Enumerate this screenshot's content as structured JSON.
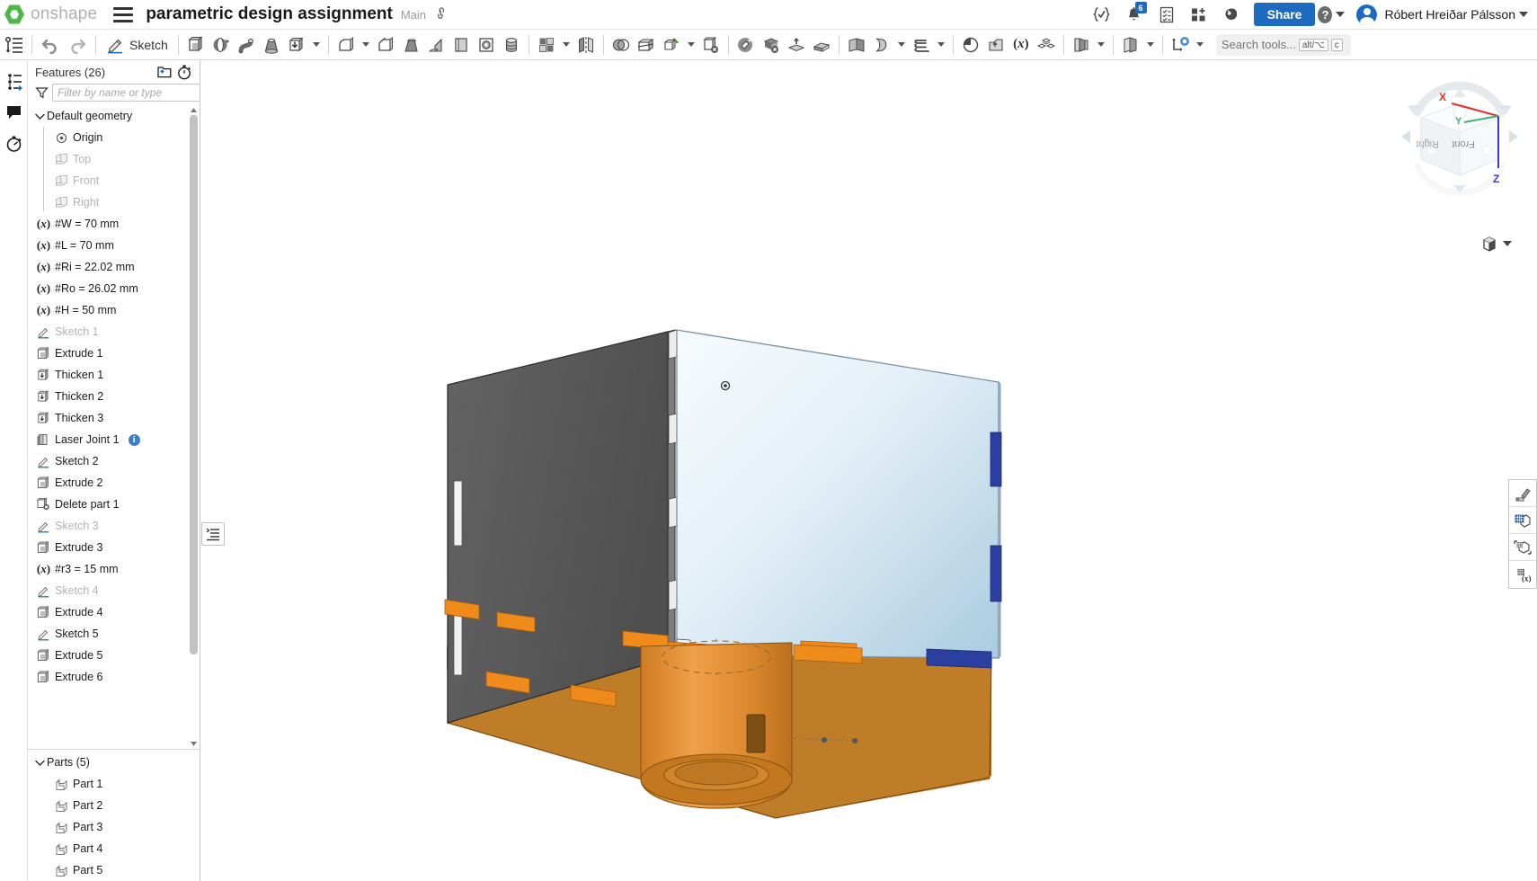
{
  "header": {
    "brand": "onshape",
    "menu_icon": "hamburger-icon",
    "doc_title": "parametric design assignment",
    "branch": "Main",
    "link_icon": "link-icon",
    "icons": [
      {
        "name": "feature-script-icon",
        "glyph": "{✓}"
      },
      {
        "name": "notifications-icon",
        "glyph": "bell",
        "badge": "6"
      },
      {
        "name": "tasks-icon",
        "glyph": "checklist"
      },
      {
        "name": "apps-icon",
        "glyph": "grid-plus"
      },
      {
        "name": "learning-icon",
        "glyph": "brain"
      }
    ],
    "share_label": "Share",
    "help_icon": "question-mark-icon",
    "user_name": "Róbert Hreiðar Pálsson"
  },
  "toolbar": {
    "feature_list_icon": "feature-list-icon",
    "undo_icon": "undo-arrow-icon",
    "redo_icon": "redo-arrow-icon",
    "sketch_label": "Sketch",
    "sketch_icon": "pencil-icon",
    "tools": [
      {
        "name": "extrude-tool",
        "icon": "extrude-icon"
      },
      {
        "name": "revolve-tool",
        "icon": "revolve-icon"
      },
      {
        "name": "sweep-tool",
        "icon": "sweep-icon"
      },
      {
        "name": "loft-tool",
        "icon": "loft-icon"
      },
      {
        "name": "thicken-tool",
        "icon": "thicken-icon",
        "caret": true
      },
      {
        "name": "fillet-tool",
        "icon": "fillet-icon",
        "caret": true
      },
      {
        "name": "chamfer-tool",
        "icon": "chamfer-icon"
      },
      {
        "name": "draft-tool",
        "icon": "draft-icon"
      },
      {
        "name": "rib-tool",
        "icon": "rib-icon"
      },
      {
        "name": "shell-tool",
        "icon": "shell-icon"
      },
      {
        "name": "hole-tool",
        "icon": "hole-icon"
      },
      {
        "name": "thread-tool",
        "icon": "thread-icon"
      }
    ],
    "pattern_icon": "pattern-icon",
    "mirror_icon": "mirror-icon",
    "boolean_icon": "boolean-icon",
    "split_icon": "split-icon",
    "transform_icon": "transform-icon",
    "delete_face_icon": "delete-face-icon",
    "move_face_icon": "move-face-icon",
    "replace_face_icon": "replace-face-icon",
    "offset_surface_icon": "offset-surface-icon",
    "delete_part_icon": "delete-part-icon",
    "enclose_icon": "enclose-icon",
    "surface_icon": "surface-icon",
    "curve_icon": "curve-icon",
    "derived_icon": "derived-icon",
    "import_icon": "import-icon",
    "variable_icon": "variable-icon",
    "assembly_icon": "assembly-icon",
    "sheet_metal_icon": "sheet-metal-icon",
    "config_icon": "config-icon",
    "custom_feature_icon": "custom-feature-icon",
    "search_placeholder": "Search tools...",
    "search_key_alt": "alt/⌥",
    "search_key_c": "c"
  },
  "left_rail": [
    {
      "name": "rail-insert-icon",
      "label": "insert"
    },
    {
      "name": "rail-comments-icon",
      "label": "comments"
    },
    {
      "name": "rail-history-icon",
      "label": "history"
    }
  ],
  "tree": {
    "title": "Features (26)",
    "new_folder_icon": "new-folder-icon",
    "rollback_icon": "rollback-timer-icon",
    "filter_icon": "filter-funnel-icon",
    "filter_placeholder": "Filter by name or type",
    "groups": [
      {
        "name": "Default geometry",
        "expanded": true,
        "children": [
          {
            "label": "Origin",
            "icon": "origin-icon",
            "dim": false
          },
          {
            "label": "Top",
            "icon": "plane-icon",
            "dim": true
          },
          {
            "label": "Front",
            "icon": "plane-icon",
            "dim": true
          },
          {
            "label": "Right",
            "icon": "plane-icon",
            "dim": true
          }
        ]
      }
    ],
    "features": [
      {
        "label": "#W = 70 mm",
        "icon": "variable-icon",
        "dim": false
      },
      {
        "label": "#L = 70 mm",
        "icon": "variable-icon",
        "dim": false
      },
      {
        "label": "#Ri = 22.02 mm",
        "icon": "variable-icon",
        "dim": false
      },
      {
        "label": "#Ro = 26.02 mm",
        "icon": "variable-icon",
        "dim": false
      },
      {
        "label": "#H = 50 mm",
        "icon": "variable-icon",
        "dim": false
      },
      {
        "label": "Sketch 1",
        "icon": "sketch-icon",
        "dim": true
      },
      {
        "label": "Extrude 1",
        "icon": "extrude-icon",
        "dim": false
      },
      {
        "label": "Thicken 1",
        "icon": "thicken-icon",
        "dim": false
      },
      {
        "label": "Thicken 2",
        "icon": "thicken-icon",
        "dim": false
      },
      {
        "label": "Thicken 3",
        "icon": "thicken-icon",
        "dim": false
      },
      {
        "label": "Laser Joint 1",
        "icon": "custom-feature-icon",
        "dim": false,
        "info": "i"
      },
      {
        "label": "Sketch 2",
        "icon": "sketch-icon",
        "dim": false
      },
      {
        "label": "Extrude 2",
        "icon": "extrude-icon",
        "dim": false
      },
      {
        "label": "Delete part 1",
        "icon": "delete-part-icon",
        "dim": false
      },
      {
        "label": "Sketch 3",
        "icon": "sketch-icon",
        "dim": true
      },
      {
        "label": "Extrude 3",
        "icon": "extrude-icon",
        "dim": false
      },
      {
        "label": "#r3 = 15 mm",
        "icon": "variable-icon",
        "dim": false
      },
      {
        "label": "Sketch 4",
        "icon": "sketch-icon",
        "dim": true
      },
      {
        "label": "Extrude 4",
        "icon": "extrude-icon",
        "dim": false
      },
      {
        "label": "Sketch 5",
        "icon": "sketch-icon",
        "dim": false
      },
      {
        "label": "Extrude 5",
        "icon": "extrude-icon",
        "dim": false
      },
      {
        "label": "Extrude 6",
        "icon": "extrude-icon",
        "dim": false
      }
    ],
    "parts_title": "Parts (5)",
    "parts": [
      {
        "label": "Part 1",
        "icon": "part-icon"
      },
      {
        "label": "Part 2",
        "icon": "part-icon"
      },
      {
        "label": "Part 3",
        "icon": "part-icon"
      },
      {
        "label": "Part 4",
        "icon": "part-icon"
      },
      {
        "label": "Part 5",
        "icon": "part-icon"
      }
    ]
  },
  "viewport": {
    "list_toggle_icon": "list-panel-icon",
    "viewcube": {
      "face_right": "Right",
      "face_front": "Front",
      "axis_x": "X",
      "axis_y": "Y",
      "axis_z": "Z",
      "color_x": "#e03030",
      "color_y": "#3cb371",
      "color_z": "#3b3bd0"
    },
    "display_style_icon": "display-style-icon",
    "right_tools": [
      {
        "name": "appearance-icon"
      },
      {
        "name": "section-view-icon"
      },
      {
        "name": "explode-view-icon"
      },
      {
        "name": "measure-variable-icon"
      }
    ]
  },
  "model_colors": {
    "dark_panel": "#595959",
    "glass_panel": "#dceaf5",
    "wood_base": "#c87f2a",
    "orange_tab": "#ef8b1b",
    "blue_tab": "#2b3fa0",
    "cylinder": "#e08a2e"
  }
}
